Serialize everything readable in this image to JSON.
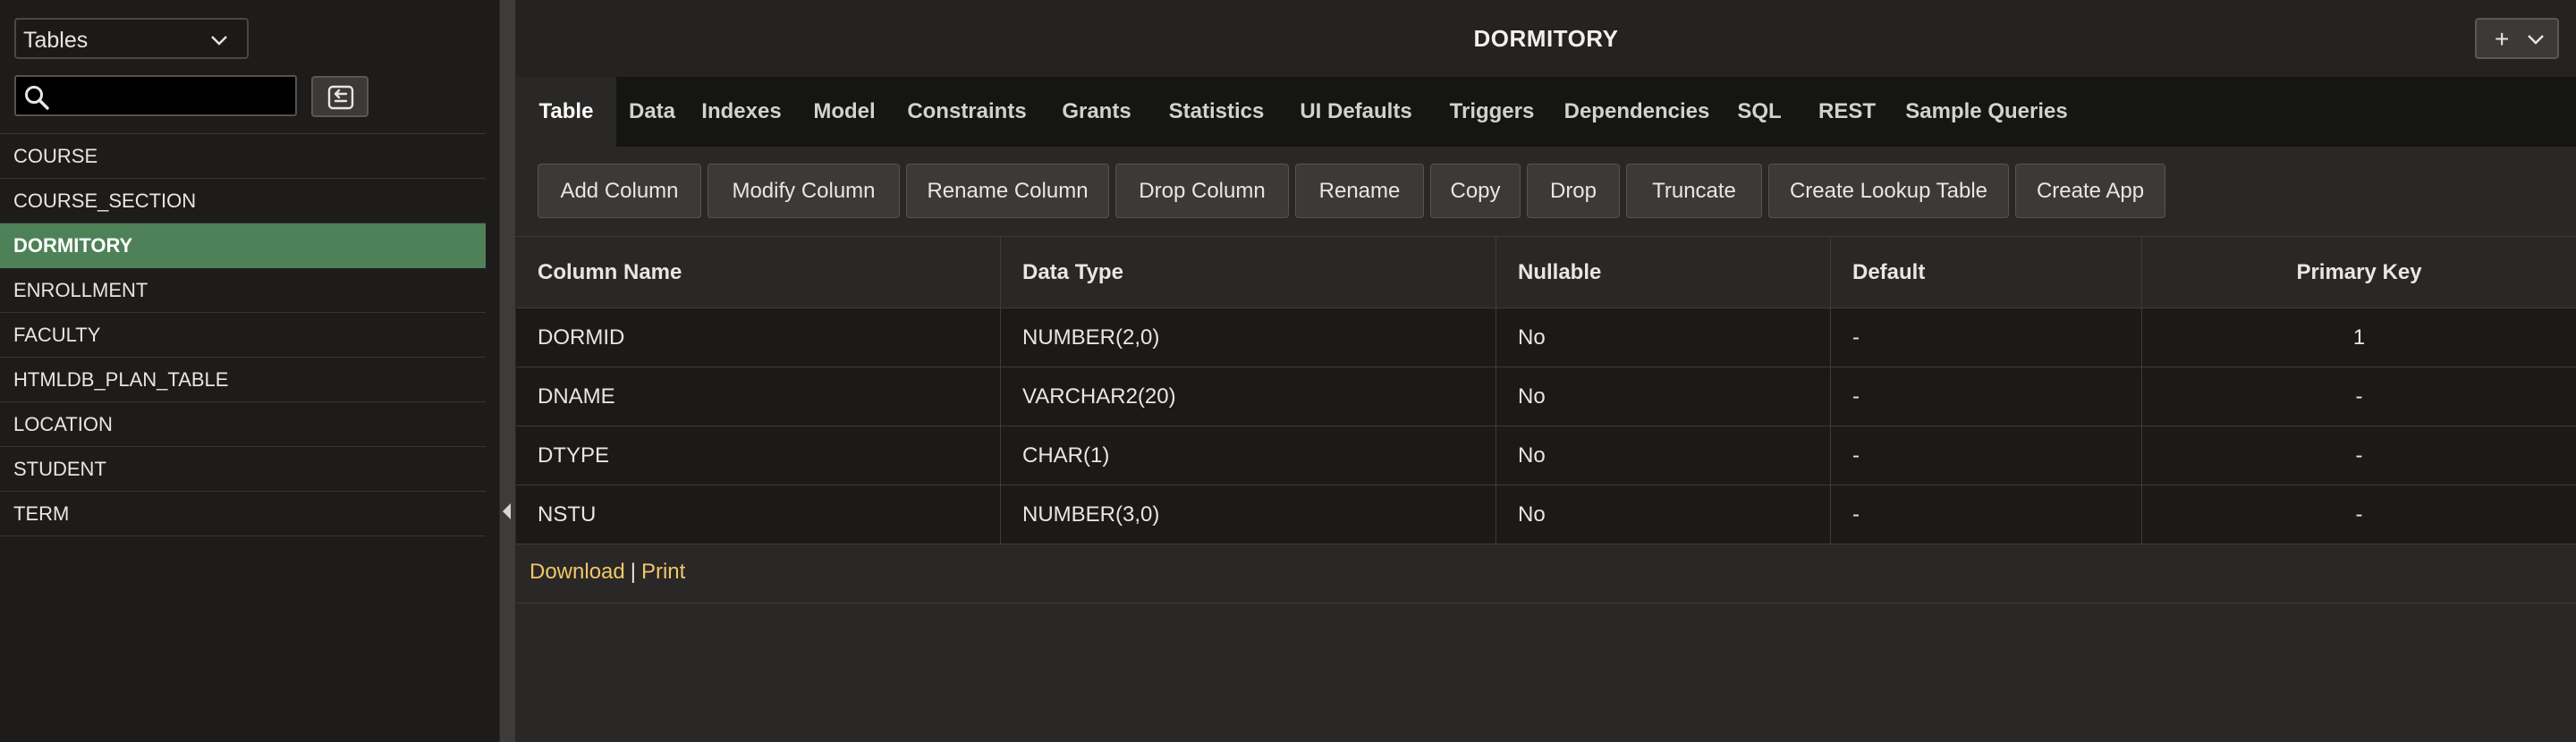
{
  "sidebar": {
    "object_type": "Tables",
    "search": {
      "value": "",
      "placeholder": ""
    },
    "items": [
      "COURSE",
      "COURSE_SECTION",
      "DORMITORY",
      "ENROLLMENT",
      "FACULTY",
      "HTMLDB_PLAN_TABLE",
      "LOCATION",
      "STUDENT",
      "TERM"
    ],
    "selected": "DORMITORY"
  },
  "header": {
    "title": "DORMITORY",
    "add_button": "+"
  },
  "tabs": [
    "Table",
    "Data",
    "Indexes",
    "Model",
    "Constraints",
    "Grants",
    "Statistics",
    "UI Defaults",
    "Triggers",
    "Dependencies",
    "SQL",
    "REST",
    "Sample Queries"
  ],
  "active_tab": "Table",
  "toolbar": [
    "Add Column",
    "Modify Column",
    "Rename Column",
    "Drop Column",
    "Rename",
    "Copy",
    "Drop",
    "Truncate",
    "Create Lookup Table",
    "Create App"
  ],
  "table": {
    "columns": [
      "Column Name",
      "Data Type",
      "Nullable",
      "Default",
      "Primary Key"
    ],
    "rows": [
      [
        "DORMID",
        "NUMBER(2,0)",
        "No",
        "-",
        "1"
      ],
      [
        "DNAME",
        "VARCHAR2(20)",
        "No",
        "-",
        "-"
      ],
      [
        "DTYPE",
        "CHAR(1)",
        "No",
        "-",
        "-"
      ],
      [
        "NSTU",
        "NUMBER(3,0)",
        "No",
        "-",
        "-"
      ]
    ]
  },
  "footer": {
    "download": "Download",
    "separator": "|",
    "print": "Print"
  },
  "colors": {
    "selected_item": "#4e8157",
    "link": "#f1c66a"
  }
}
